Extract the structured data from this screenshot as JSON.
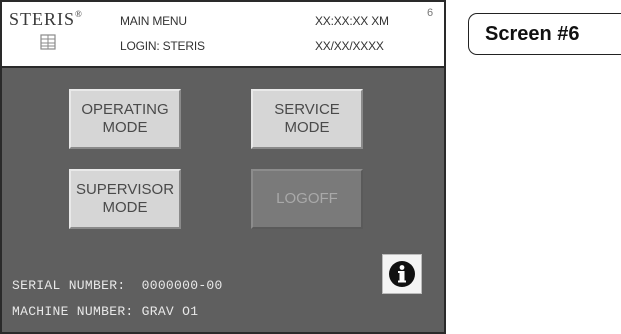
{
  "header": {
    "brand": "STERIS",
    "brand_mark": "®",
    "menu_title": "MAIN MENU",
    "login": "LOGIN: STERIS",
    "time": "XX:XX:XX XM",
    "date": "XX/XX/XXXX",
    "screen_number": "6"
  },
  "buttons": {
    "operating_mode": "OPERATING\nMODE",
    "service_mode": "SERVICE\nMODE",
    "supervisor_mode": "SUPERVISOR\nMODE",
    "logoff": "LOGOFF"
  },
  "info": {
    "serial_line": "SERIAL NUMBER:  0000000-00",
    "machine_line": "MACHINE NUMBER: GRAV O1"
  },
  "info_button_icon": "info-icon",
  "screen_tag": "Screen #6",
  "colors": {
    "panel_bg": "#5f5f5f",
    "button_bg": "#d6d6d6",
    "button_disabled_bg": "#7a7a7a"
  }
}
